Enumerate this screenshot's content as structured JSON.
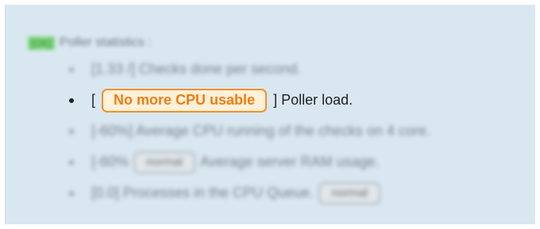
{
  "header": {
    "ok_tag": "[OK]",
    "title": "Poller statistics :"
  },
  "stats": [
    {
      "prefix": "[1.33 /] Checks done per second."
    },
    {
      "open_bracket": "[",
      "badge": "No more CPU usable",
      "close_text": "] Poller load.",
      "badge_color": "#f0912c"
    },
    {
      "prefix": "[-60%] Average CPU running of the checks on 4 core."
    },
    {
      "prefix": "[-60%",
      "badge": "normal",
      "suffix": "Average server RAM usage."
    },
    {
      "prefix": "[0.0] Processes in the CPU Queue.",
      "badge": "normal"
    }
  ],
  "colors": {
    "panel_bg": "#d9e7f1",
    "ok_green": "#6fd66a",
    "warning_orange": "#f0912c",
    "neutral_grey": "#9ea5aa"
  }
}
